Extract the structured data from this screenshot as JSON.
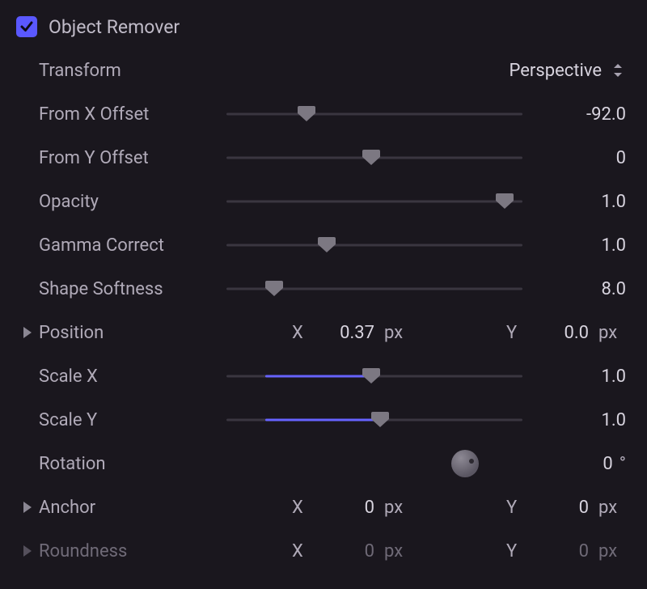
{
  "section_title": "Object Remover",
  "rows": {
    "transform": {
      "label": "Transform",
      "selected": "Perspective"
    },
    "from_x_offset": {
      "label": "From X Offset",
      "value": "-92.0",
      "thumb_pct": 27
    },
    "from_y_offset": {
      "label": "From Y Offset",
      "value": "0",
      "thumb_pct": 49
    },
    "opacity": {
      "label": "Opacity",
      "value": "1.0",
      "thumb_pct": 94
    },
    "gamma_correct": {
      "label": "Gamma Correct",
      "value": "1.0",
      "thumb_pct": 34
    },
    "shape_softness": {
      "label": "Shape Softness",
      "value": "8.0",
      "thumb_pct": 16
    },
    "position": {
      "label": "Position",
      "x_value": "0.37",
      "y_value": "0.0",
      "unit": "px"
    },
    "scale_x": {
      "label": "Scale X",
      "value": "1.0",
      "fill_from_pct": 13,
      "thumb_pct": 49
    },
    "scale_y": {
      "label": "Scale Y",
      "value": "1.0",
      "fill_from_pct": 13,
      "thumb_pct": 52
    },
    "rotation": {
      "label": "Rotation",
      "value": "0",
      "unit": "°"
    },
    "anchor": {
      "label": "Anchor",
      "x_value": "0",
      "y_value": "0",
      "unit": "px"
    },
    "roundness": {
      "label": "Roundness",
      "x_value": "0",
      "y_value": "0",
      "unit": "px"
    }
  },
  "axis_x_label": "X",
  "axis_y_label": "Y"
}
